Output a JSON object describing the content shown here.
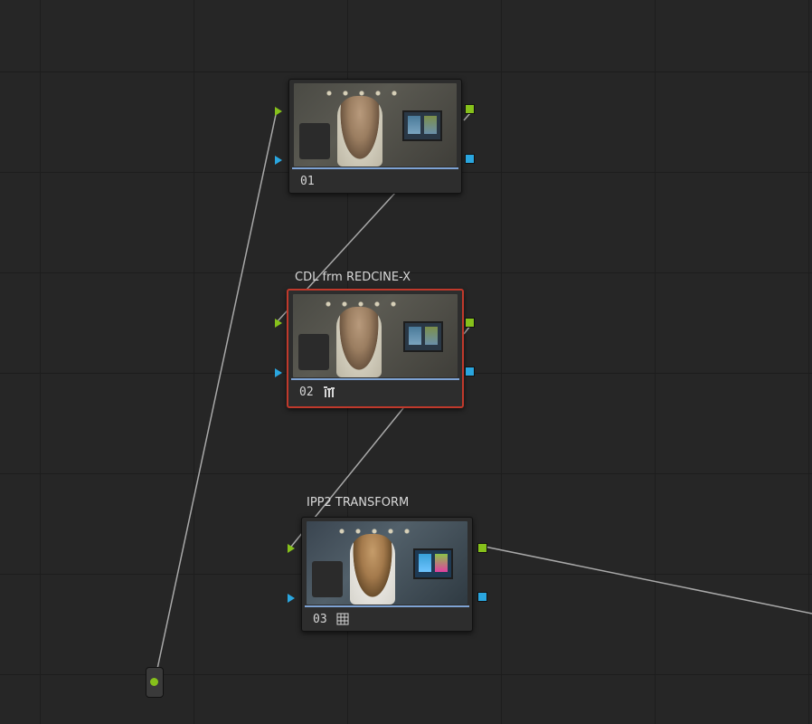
{
  "colors": {
    "background": "#262626",
    "rgb_port": "#86c11b",
    "alpha_port": "#2aa6df",
    "selected_border": "#c0392b",
    "connection_line": "#a9a9a9"
  },
  "nodes": [
    {
      "number": "01",
      "label": "",
      "selected": false,
      "badge_icon": ""
    },
    {
      "number": "02",
      "label": "CDL frm REDCINE-X",
      "selected": true,
      "badge_icon": "cdl-bars-icon"
    },
    {
      "number": "03",
      "label": "IPP2 TRANSFORM",
      "selected": false,
      "badge_icon": "lut-grid-icon"
    }
  ],
  "source": {
    "icon": "source-input-icon"
  }
}
